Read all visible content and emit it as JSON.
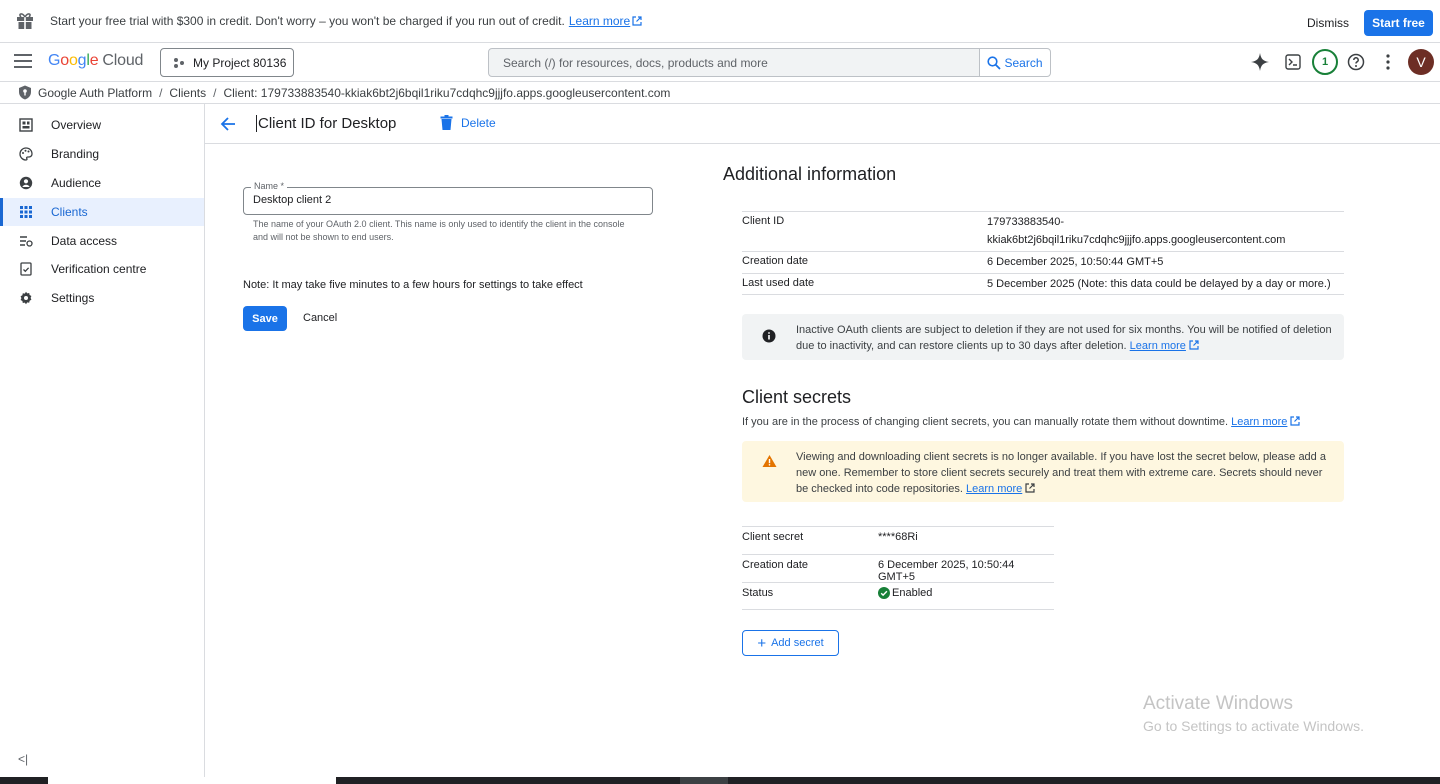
{
  "promo": {
    "text": "Start your free trial with $300 in credit. Don't worry – you won't be charged if you run out of credit.",
    "learn_more": "Learn more",
    "dismiss": "Dismiss",
    "start_free": "Start free"
  },
  "topnav": {
    "logo": {
      "G": "G",
      "o1": "o",
      "o2": "o",
      "g": "g",
      "l": "l",
      "e": "e",
      "cloud": "Cloud"
    },
    "project": "My Project 80136",
    "search_placeholder": "Search (/) for resources, docs, products and more",
    "search_button": "Search",
    "notification_count": "1",
    "avatar_letter": "V",
    "colors": {
      "accent": "#1a73e8",
      "badge": "#188038",
      "avatar_bg": "#6d2e25"
    }
  },
  "breadcrumb": {
    "items": [
      "Google Auth Platform",
      "Clients",
      "Client: 179733883540-kkiak6bt2j6bqil1riku7cdqhc9jjjfo.apps.googleusercontent.com"
    ],
    "separator": "/"
  },
  "sidebar": {
    "items": [
      {
        "label": "Overview",
        "icon": "dashboard-icon"
      },
      {
        "label": "Branding",
        "icon": "palette-icon"
      },
      {
        "label": "Audience",
        "icon": "person-icon"
      },
      {
        "label": "Clients",
        "icon": "grid-icon",
        "active": true
      },
      {
        "label": "Data access",
        "icon": "data-access-icon"
      },
      {
        "label": "Verification centre",
        "icon": "verified-icon"
      },
      {
        "label": "Settings",
        "icon": "gear-icon"
      }
    ],
    "collapse": "<|"
  },
  "main": {
    "title": "Client ID for Desktop",
    "delete": "Delete",
    "form": {
      "name_label": "Name *",
      "name_value": "Desktop client 2",
      "helper": "The name of your OAuth 2.0 client. This name is only used to identify the client in the console and will not be shown to end users.",
      "note": "Note: It may take five minutes to a few hours for settings to take effect",
      "save": "Save",
      "cancel": "Cancel"
    },
    "additional": {
      "heading": "Additional information",
      "rows": [
        {
          "key": "Client ID",
          "value_line1": "179733883540-",
          "value_line2": "kkiak6bt2j6bqil1riku7cdqhc9jjjfo.apps.googleusercontent.com"
        },
        {
          "key": "Creation date",
          "value": "6 December 2025, 10:50:44 GMT+5"
        },
        {
          "key": "Last used date",
          "value": "5 December 2025 (Note: this data could be delayed by a day or more.)"
        }
      ],
      "info": "Inactive OAuth clients are subject to deletion if they are not used for six months. You will be notified of deletion due to inactivity, and can restore clients up to 30 days after deletion.",
      "info_link": "Learn more"
    },
    "secrets": {
      "heading": "Client secrets",
      "desc": "If you are in the process of changing client secrets, you can manually rotate them without downtime.",
      "desc_link": "Learn more",
      "warning": "Viewing and downloading client secrets is no longer available. If you have lost the secret below, please add a new one. Remember to store client secrets securely and treat them with extreme care. Secrets should never be checked into code repositories.",
      "warning_link": "Learn more",
      "rows": [
        {
          "key": "Client secret",
          "value": "****68Ri"
        },
        {
          "key": "Creation date",
          "value": "6 December 2025, 10:50:44 GMT+5"
        },
        {
          "key": "Status",
          "value": "Enabled"
        }
      ],
      "add_secret": "Add secret",
      "colors": {
        "warning": "#e37400",
        "enabled": "#188038"
      }
    }
  },
  "watermark": {
    "line1": "Activate Windows",
    "line2": "Go to Settings to activate Windows."
  }
}
